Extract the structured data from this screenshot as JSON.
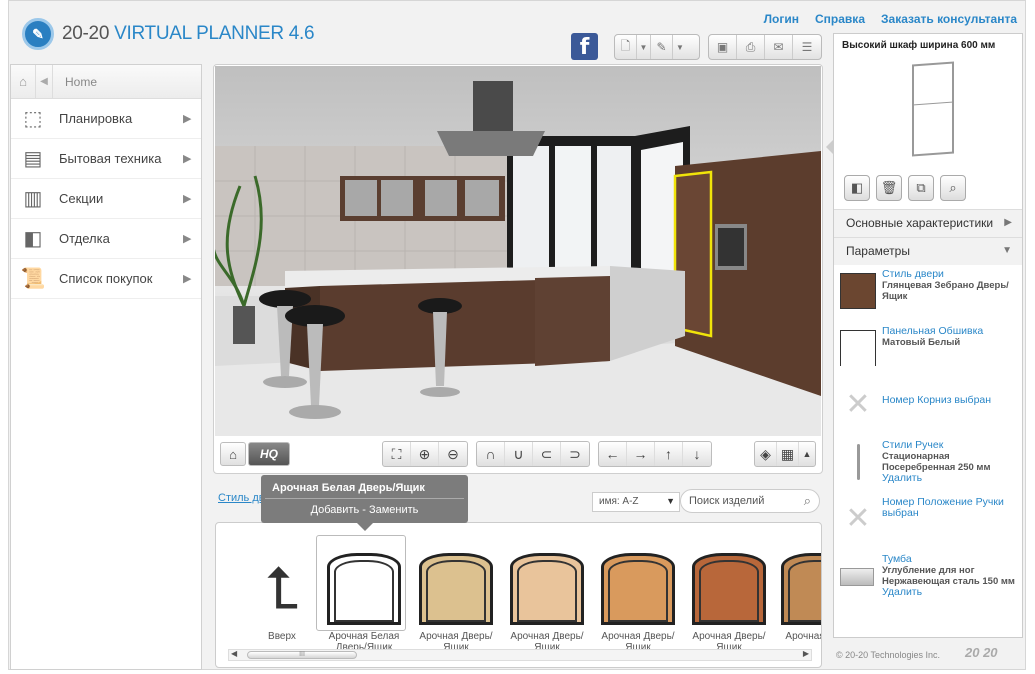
{
  "header": {
    "logo_prefix": "20-20",
    "logo_name": "VIRTUAL PLANNER 4.6",
    "links": [
      "Логин",
      "Справка",
      "Заказать консультанта"
    ],
    "facebook_label": "f"
  },
  "leftnav": {
    "crumb": "Home",
    "items": [
      {
        "label": "Планировка",
        "icon": "floorplan-icon"
      },
      {
        "label": "Бытовая техника",
        "icon": "appliance-icon"
      },
      {
        "label": "Секции",
        "icon": "cabinet-icon"
      },
      {
        "label": "Отделка",
        "icon": "finish-icon"
      },
      {
        "label": "Список покупок",
        "icon": "shopping-list-icon"
      }
    ]
  },
  "viewport": {
    "hq_label": "HQ"
  },
  "catalog": {
    "breadcrumb": "Стиль дв",
    "sort_value": "имя: A-Z",
    "search_placeholder": "Поиск изделий",
    "tooltip_title": "Арочная Белая Дверь/Ящик",
    "tooltip_add": "Добавить",
    "tooltip_sep": "-",
    "tooltip_replace": "Заменить",
    "scroll_grip": "III",
    "up_label": "Вверх",
    "items": [
      {
        "label": "Арочная Белая Дверь/Ящик",
        "color": "#ffffff"
      },
      {
        "label": "Арочная Дверь/Ящик",
        "color": "#dcc18f"
      },
      {
        "label": "Арочная Дверь/Ящик",
        "color": "#e9c49b"
      },
      {
        "label": "Арочная Дверь/Ящик",
        "color": "#d99a5d"
      },
      {
        "label": "Арочная Дверь/Ящик",
        "color": "#b8673a"
      },
      {
        "label": "Арочная Двер",
        "color": "#c08a55"
      }
    ]
  },
  "rightpanel": {
    "title": "Высокий шкаф ширина 600 мм",
    "sections": [
      "Основные характеристики",
      "Параметры"
    ],
    "params": [
      {
        "label": "Стиль двери",
        "value": "Глянцевая Зебрано Дверь/Ящик",
        "action": "",
        "swatch": "#6b4630"
      },
      {
        "label": "Панельная Обшивка",
        "value": "Матовый Белый",
        "action": "",
        "swatch": "#ffffff"
      },
      {
        "label": "Номер Корниз  выбран",
        "value": "",
        "action": "",
        "swatch": "none"
      },
      {
        "label": "Стили Ручек",
        "value": "Стационарная Посеребренная 250 мм",
        "action": "Удалить",
        "swatch": "handle"
      },
      {
        "label": "Номер Положение Ручки выбран",
        "value": "",
        "action": "",
        "swatch": "none"
      },
      {
        "label": "Тумба",
        "value": "Углубление для ног Нержавеющая сталь 150 мм",
        "action": "Удалить",
        "swatch": "plinth"
      }
    ],
    "copyright": "© 20-20 Technologies Inc.",
    "brand": "20 20"
  }
}
